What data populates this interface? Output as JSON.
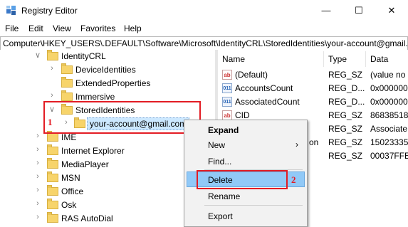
{
  "window": {
    "title": "Registry Editor",
    "minimize": "—",
    "maximize": "☐",
    "close": "✕"
  },
  "menu": [
    "File",
    "Edit",
    "View",
    "Favorites",
    "Help"
  ],
  "address": "Computer\\HKEY_USERS\\.DEFAULT\\Software\\Microsoft\\IdentityCRL\\StoredIdentities\\your-account@gmail.com",
  "tree": [
    {
      "label": "IdentityCRL",
      "arrow": "∨"
    },
    {
      "label": "DeviceIdentities",
      "arrow": "›"
    },
    {
      "label": "ExtendedProperties",
      "arrow": ""
    },
    {
      "label": "Immersive",
      "arrow": "›"
    },
    {
      "label": "StoredIdentities",
      "arrow": "∨"
    },
    {
      "label": "your-account@gmail.com",
      "arrow": "›"
    },
    {
      "label": "IME",
      "arrow": "›"
    },
    {
      "label": "Internet Explorer",
      "arrow": "›"
    },
    {
      "label": "MediaPlayer",
      "arrow": "›"
    },
    {
      "label": "MSN",
      "arrow": "›"
    },
    {
      "label": "Office",
      "arrow": "›"
    },
    {
      "label": "Osk",
      "arrow": "›"
    },
    {
      "label": "RAS AutoDial",
      "arrow": "›"
    }
  ],
  "list": {
    "headers": [
      "Name",
      "Type",
      "Data"
    ],
    "rows": [
      {
        "icon": "ab",
        "name": "(Default)",
        "type": "REG_SZ",
        "data": "(value no"
      },
      {
        "icon": "bin",
        "name": "AccountsCount",
        "type": "REG_D...",
        "data": "0x000000"
      },
      {
        "icon": "bin",
        "name": "AssociatedCount",
        "type": "REG_D...",
        "data": "0x000000"
      },
      {
        "icon": "ab",
        "name": "CID",
        "type": "REG_SZ",
        "data": "86838518"
      },
      {
        "icon": "ab",
        "name": "",
        "type": "REG_SZ",
        "data": "Associate"
      },
      {
        "icon": "ab",
        "name": "on",
        "type": "REG_SZ",
        "data": "15023335"
      },
      {
        "icon": "ab",
        "name": "",
        "type": "REG_SZ",
        "data": "00037FFE"
      }
    ]
  },
  "context_menu": {
    "expand": "Expand",
    "new": "New",
    "find": "Find...",
    "delete": "Delete",
    "rename": "Rename",
    "export": "Export",
    "submenu_arrow": "›"
  },
  "annotations": {
    "marker_1": "1",
    "marker_2": "2"
  },
  "colors": {
    "annotation_red": "#e31c24",
    "selection": "#cce8ff",
    "menu_highlight": "#91c9f7"
  }
}
